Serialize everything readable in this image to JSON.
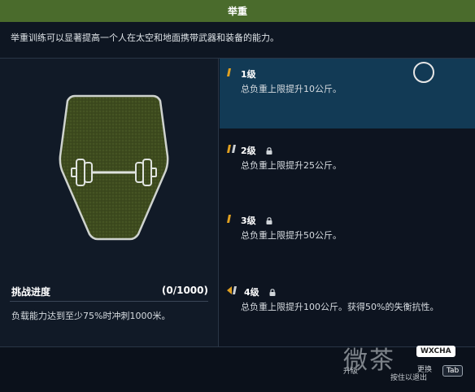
{
  "window": {
    "title": "举重"
  },
  "description": "举重训练可以显著提高一个人在太空和地面携带武器和装备的能力。",
  "challenge": {
    "title": "挑战进度",
    "progress": "(0/1000)",
    "text": "负载能力达到至少75%时冲刺1000米。"
  },
  "levels": [
    {
      "name": "1级",
      "text": "总负重上限提升10公斤。",
      "locked": false,
      "active": true
    },
    {
      "name": "2级",
      "text": "总负重上限提升25公斤。",
      "locked": true,
      "active": false
    },
    {
      "name": "3级",
      "text": "总负重上限提升50公斤。",
      "locked": true,
      "active": false
    },
    {
      "name": "4级",
      "text": "总负重上限提升100公斤。获得50%的失衡抗性。",
      "locked": true,
      "active": false
    }
  ],
  "footer": {
    "hint_left": "升级",
    "hint_mid": "按住以退出",
    "hint_right": "更换",
    "key_tab": "Tab"
  },
  "watermark": {
    "text": "微茶",
    "badge": "WXCHA"
  },
  "colors": {
    "title_bar": "#4a6b2c",
    "active_level": "#123a55",
    "tier_marker": "#e0a020",
    "background": "#0d1420"
  },
  "icons": {
    "emblem": "dumbbell-hexagon-icon",
    "lock": "lock-icon",
    "tier_marker": "tier-bars-icon"
  }
}
